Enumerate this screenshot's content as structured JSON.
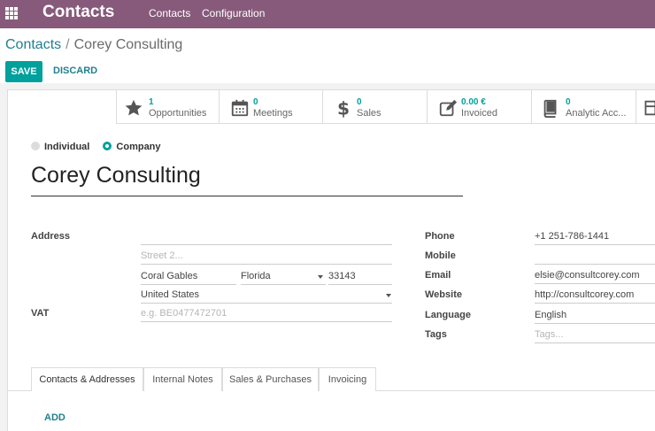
{
  "navbar": {
    "brand": "Contacts",
    "menu": [
      "Contacts",
      "Configuration"
    ]
  },
  "breadcrumb": {
    "parent": "Contacts",
    "separator": "/",
    "current": "Corey Consulting"
  },
  "buttons": {
    "save": "SAVE",
    "discard": "DISCARD",
    "add": "ADD"
  },
  "stat_buttons": [
    {
      "value": "1",
      "label": "Opportunities",
      "icon": "star-icon"
    },
    {
      "value": "0",
      "label": "Meetings",
      "icon": "calendar-icon"
    },
    {
      "value": "0",
      "label": "Sales",
      "icon": "dollar-icon"
    },
    {
      "value": "0.00 €",
      "label": "Invoiced",
      "icon": "pencil-square-icon"
    },
    {
      "value": "0",
      "label": "Analytic Acc...",
      "icon": "book-icon"
    }
  ],
  "company_type": {
    "individual": "Individual",
    "company": "Company",
    "selected": "Company"
  },
  "name": "Corey Consulting",
  "address": {
    "label": "Address",
    "street2_placeholder": "Street 2...",
    "city": "Coral Gables",
    "state": "Florida",
    "zip": "33143",
    "country": "United States"
  },
  "vat": {
    "label": "VAT",
    "placeholder": "e.g. BE0477472701"
  },
  "contact": {
    "phone_label": "Phone",
    "phone": "+1 251-786-1441",
    "mobile_label": "Mobile",
    "mobile": "",
    "email_label": "Email",
    "email": "elsie@consultcorey.com",
    "website_label": "Website",
    "website": "http://consultcorey.com",
    "language_label": "Language",
    "language": "English",
    "tags_label": "Tags",
    "tags_placeholder": "Tags..."
  },
  "tabs": [
    "Contacts & Addresses",
    "Internal Notes",
    "Sales & Purchases",
    "Invoicing"
  ],
  "colors": {
    "navbar": "#875a7b",
    "primary": "#00a09d",
    "link": "#217f8f"
  }
}
